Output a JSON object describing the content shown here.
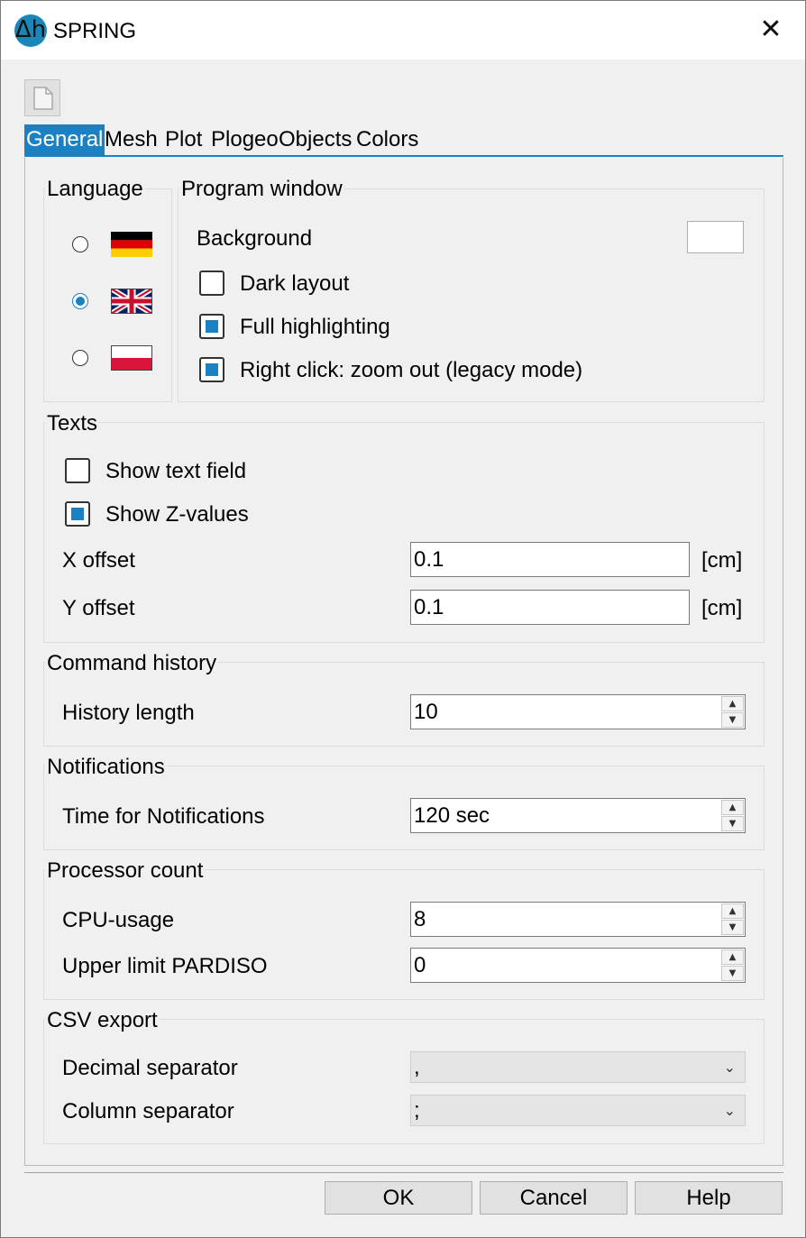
{
  "window": {
    "title": "SPRING",
    "icon": "app-logo-icon",
    "icon_glyph": "Δh",
    "close_glyph": "✕"
  },
  "toolbar": {
    "new_icon": "document-icon"
  },
  "tabs": [
    {
      "label": "General",
      "active": true
    },
    {
      "label": "Mesh"
    },
    {
      "label": "Plot"
    },
    {
      "label": "Plogeo"
    },
    {
      "label": "Objects"
    },
    {
      "label": "Colors"
    }
  ],
  "language": {
    "title": "Language",
    "options": [
      {
        "flag": "germany-flag-icon",
        "selected": false
      },
      {
        "flag": "uk-flag-icon",
        "selected": true
      },
      {
        "flag": "poland-flag-icon",
        "selected": false
      }
    ]
  },
  "program_window": {
    "title": "Program window",
    "background_label": "Background",
    "background_color": "#ffffff",
    "dark_layout": {
      "label": "Dark layout",
      "checked": false
    },
    "full_highlighting": {
      "label": "Full highlighting",
      "checked": true
    },
    "right_click": {
      "label": "Right click: zoom out (legacy mode)",
      "checked": true
    }
  },
  "texts": {
    "title": "Texts",
    "show_text_field": {
      "label": "Show text field",
      "checked": false
    },
    "show_z_values": {
      "label": "Show Z-values",
      "checked": true
    },
    "x_offset": {
      "label": "X offset",
      "value": "0.1",
      "unit": "[cm]"
    },
    "y_offset": {
      "label": "Y offset",
      "value": "0.1",
      "unit": "[cm]"
    }
  },
  "command_history": {
    "title": "Command history",
    "history_length": {
      "label": "History length",
      "value": "10"
    }
  },
  "notifications": {
    "title": "Notifications",
    "time": {
      "label": "Time for Notifications",
      "value": "120 sec"
    }
  },
  "processor_count": {
    "title": "Processor count",
    "cpu_usage": {
      "label": "CPU-usage",
      "value": "8"
    },
    "pardiso": {
      "label": "Upper limit PARDISO",
      "value": "0"
    }
  },
  "csv_export": {
    "title": "CSV export",
    "decimal_separator": {
      "label": "Decimal separator",
      "value": ","
    },
    "column_separator": {
      "label": "Column separator",
      "value": ";"
    }
  },
  "buttons": {
    "ok": "OK",
    "cancel": "Cancel",
    "help": "Help"
  },
  "glyphs": {
    "spin_up": "▲",
    "spin_down": "▼",
    "chevron_down": "⌄"
  },
  "colors": {
    "accent": "#1a82c4"
  }
}
